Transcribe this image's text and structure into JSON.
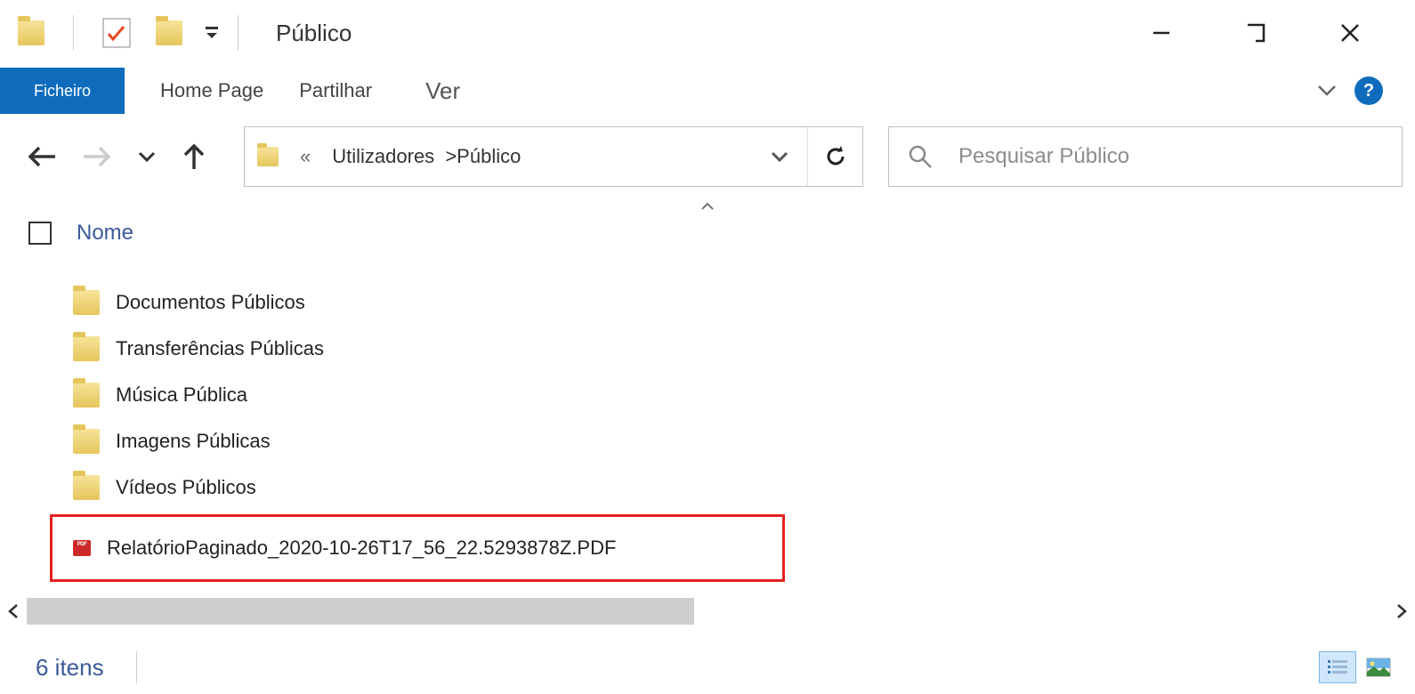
{
  "window": {
    "title": "Público"
  },
  "ribbon": {
    "file": "Ficheiro",
    "tabs": [
      "Home Page",
      "Partilhar",
      "Ver"
    ]
  },
  "address": {
    "crumb_prefix": "«",
    "crumb_1": "Utilizadores",
    "crumb_sep": ">",
    "crumb_2": "Público"
  },
  "search": {
    "placeholder": "Pesquisar Público"
  },
  "columns": {
    "name": "Nome"
  },
  "items": [
    {
      "name": "Documentos Públicos",
      "type": "folder"
    },
    {
      "name": "Transferências Públicas",
      "type": "folder"
    },
    {
      "name": "Música Pública",
      "type": "folder"
    },
    {
      "name": "Imagens Públicas",
      "type": "folder"
    },
    {
      "name": "Vídeos Públicos",
      "type": "folder"
    },
    {
      "name": "RelatórioPaginado_2020-10-26T17_56_22.5293878Z.PDF",
      "type": "pdf",
      "highlighted": true
    }
  ],
  "status": {
    "count_text": "6 itens"
  }
}
